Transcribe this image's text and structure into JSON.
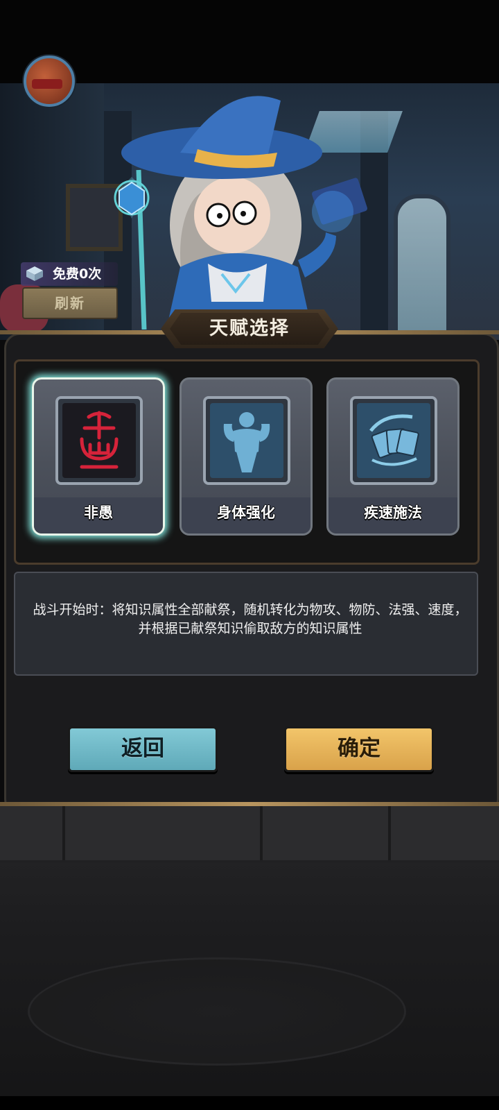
{
  "header": {
    "free_refresh_text": "免费0次",
    "refresh_label": "刷新"
  },
  "panel": {
    "title": "天赋选择",
    "cards": [
      {
        "label": "非愚",
        "selected": true,
        "icon": "rune-glyph-icon",
        "icon_color": "#d6233a"
      },
      {
        "label": "身体强化",
        "selected": false,
        "icon": "muscle-body-icon",
        "icon_color": "#5aa0c8"
      },
      {
        "label": "疾速施法",
        "selected": false,
        "icon": "casting-cards-icon",
        "icon_color": "#5aa0c8"
      }
    ],
    "description": "战斗开始时：将知识属性全部献祭，随机转化为物攻、物防、法强、速度，并根据已献祭知识偷取敌方的知识属性"
  },
  "buttons": {
    "back_label": "返回",
    "confirm_label": "确定"
  },
  "colors": {
    "back_button": "#6fb9c7",
    "confirm_button": "#e6b45a",
    "selected_glow": "#7fe0d8"
  }
}
